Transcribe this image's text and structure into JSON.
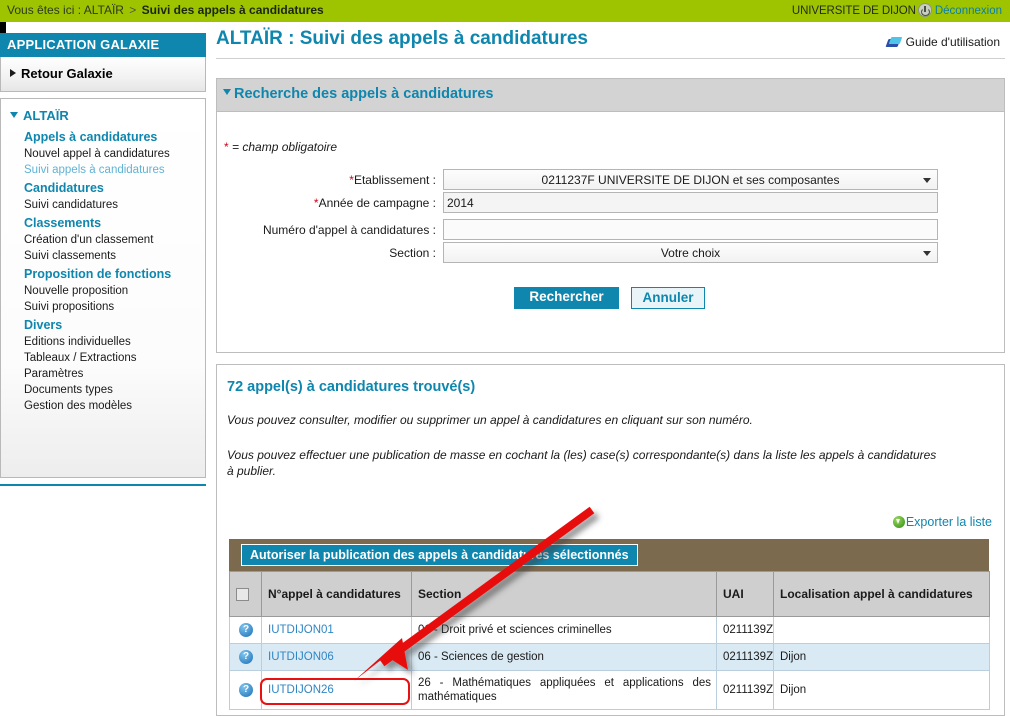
{
  "topbar": {
    "breadcrumb_prefix": "Vous êtes ici : ALTAÏR",
    "breadcrumb_sep": ">",
    "breadcrumb_current": "Suivi des appels à candidatures",
    "university": "UNIVERSITE DE DIJON",
    "power_icon": "power-icon",
    "logout": "Déconnexion"
  },
  "sidebar": {
    "header": "APPLICATION GALAXIE",
    "return": "Retour Galaxie",
    "root": "ALTAÏR",
    "items": [
      {
        "label": "Appels à candidatures",
        "type": "group"
      },
      {
        "label": "Nouvel appel à candidatures",
        "type": "item"
      },
      {
        "label": "Suivi appels à candidatures",
        "type": "item",
        "active": true
      },
      {
        "label": "Candidatures",
        "type": "group"
      },
      {
        "label": "Suivi candidatures",
        "type": "item"
      },
      {
        "label": "Classements",
        "type": "group"
      },
      {
        "label": "Création d'un classement",
        "type": "item"
      },
      {
        "label": "Suivi classements",
        "type": "item"
      },
      {
        "label": "Proposition de fonctions",
        "type": "group"
      },
      {
        "label": "Nouvelle proposition",
        "type": "item"
      },
      {
        "label": "Suivi propositions",
        "type": "item"
      },
      {
        "label": "Divers",
        "type": "group"
      },
      {
        "label": "Editions individuelles",
        "type": "item"
      },
      {
        "label": "Tableaux / Extractions",
        "type": "item"
      },
      {
        "label": "Paramètres",
        "type": "item"
      },
      {
        "label": "Documents types",
        "type": "item"
      },
      {
        "label": "Gestion des modèles",
        "type": "item"
      }
    ]
  },
  "main": {
    "page_title": "ALTAÏR : Suivi des appels à candidatures",
    "guide_link": "Guide d'utilisation",
    "guide_icon": "book-icon"
  },
  "search_panel": {
    "header": "Recherche des appels à candidatures",
    "required_note_star": "*",
    "required_note": "= champ obligatoire",
    "fields": [
      {
        "label": "Etablissement :",
        "required": true,
        "control": "select",
        "value": "0211237F UNIVERSITE DE DIJON et ses composantes"
      },
      {
        "label": "Année de campagne :",
        "required": true,
        "control": "text",
        "value": "2014",
        "placeholder": ""
      },
      {
        "label": "Numéro d'appel à candidatures :",
        "required": false,
        "control": "text",
        "value": "",
        "placeholder": ""
      },
      {
        "label": "Section :",
        "required": false,
        "control": "select",
        "value": "Votre choix"
      }
    ],
    "submit_label": "Rechercher",
    "cancel_label": "Annuler"
  },
  "results_panel": {
    "title": "72 appel(s) à candidatures trouvé(s)",
    "paragraph_1": "Vous pouvez consulter, modifier ou supprimer un appel à candidatures en cliquant sur son numéro.",
    "paragraph_2": "Vous pouvez effectuer une publication de masse en cochant la (les) case(s) correspondante(s) dans la liste les appels à candidatures à publier.",
    "export_label": "Exporter la liste",
    "export_icon": "export-download-icon",
    "publish_button": "Autoriser la publication des appels à candidatures sélectionnés",
    "columns": [
      "",
      "N°appel à candidatures",
      "Section",
      "UAI",
      "Localisation appel à candidatures"
    ],
    "rows": [
      {
        "help_icon": "help-icon",
        "numero": "IUTDIJON01",
        "section": "01 - Droit privé et sciences criminelles",
        "uai": "0211139Z",
        "localisation": ""
      },
      {
        "help_icon": "help-icon",
        "numero": "IUTDIJON06",
        "section": "06 - Sciences de gestion",
        "uai": "0211139Z",
        "localisation": "Dijon"
      },
      {
        "help_icon": "help-icon",
        "numero": "IUTDIJON26",
        "section": "26 - Mathématiques appliquées et applications des mathématiques",
        "uai": "0211139Z",
        "localisation": "Dijon",
        "highlighted": true
      }
    ]
  },
  "colors": {
    "green_bar": "#9ec400",
    "teal": "#0e86ae",
    "toolbar_brown": "#7c6a4f",
    "row_alt": "#daeaf4",
    "annotation_red": "#e81010",
    "required_star": "#d0021b"
  }
}
